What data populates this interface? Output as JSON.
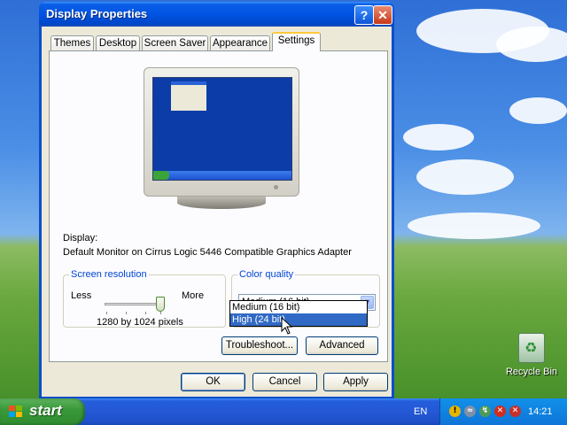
{
  "window": {
    "title": "Display Properties",
    "help_label": "?",
    "close_label": "✕"
  },
  "tabs": [
    {
      "label": "Themes"
    },
    {
      "label": "Desktop"
    },
    {
      "label": "Screen Saver"
    },
    {
      "label": "Appearance"
    },
    {
      "label": "Settings"
    }
  ],
  "active_tab": "Settings",
  "display": {
    "label": "Display:",
    "device": "Default Monitor on Cirrus Logic 5446 Compatible Graphics Adapter"
  },
  "resolution": {
    "legend": "Screen resolution",
    "less": "Less",
    "more": "More",
    "value_text": "1280 by 1024 pixels",
    "slider_level": 1.0
  },
  "color_quality": {
    "legend": "Color quality",
    "selected": "Medium (16 bit)",
    "options": [
      "Medium (16 bit)",
      "High (24 bit)"
    ],
    "highlighted": "High (24 bit)"
  },
  "buttons": {
    "troubleshoot": "Troubleshoot...",
    "advanced": "Advanced",
    "ok": "OK",
    "cancel": "Cancel",
    "apply": "Apply"
  },
  "desktop": {
    "recycle_bin": "Recycle Bin"
  },
  "taskbar": {
    "start": "start",
    "language": "EN",
    "clock": "14:21"
  },
  "colors": {
    "title_bar": "#0054e3",
    "dialog_bg": "#ece9d8",
    "selection": "#316ac5",
    "group_legend": "#0046d5"
  }
}
